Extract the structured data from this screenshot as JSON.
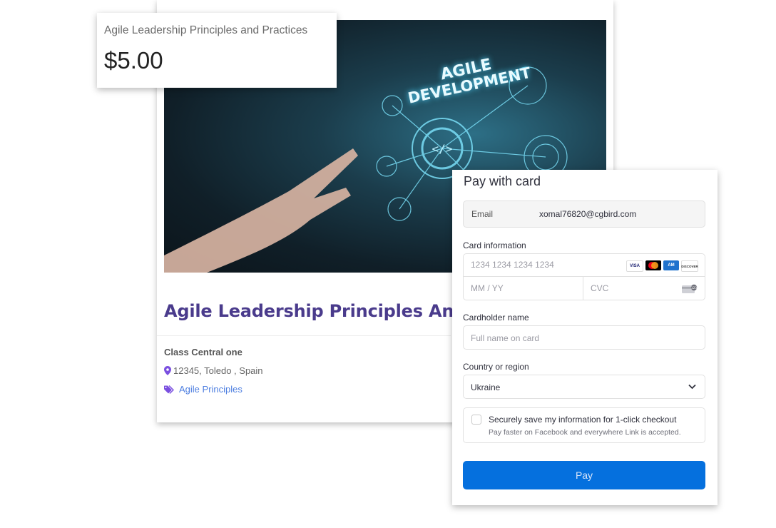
{
  "price_box": {
    "course_name": "Agile Leadership Principles and Practices",
    "price": "$5.00"
  },
  "course": {
    "hero_text_line1": "AGILE",
    "hero_text_line2": "DEVELOPMENT",
    "title": "Agile Leadership Principles And",
    "provider": "Class Central one",
    "location": "12345, Toledo , Spain",
    "tag": "Agile Principles",
    "accent_color": "#4a3b8c",
    "icons": {
      "location": "map-pin-icon",
      "tag": "tags-icon"
    }
  },
  "payment": {
    "title": "Pay with card",
    "email_label": "Email",
    "email_value": "xomal76820@cgbird.com",
    "card_info_label": "Card information",
    "card_number_placeholder": "1234 1234 1234 1234",
    "brands": [
      "VISA",
      "Mastercard",
      "Amex",
      "DISCOVER"
    ],
    "expiry_placeholder": "MM / YY",
    "cvc_placeholder": "CVC",
    "cardholder_label": "Cardholder name",
    "cardholder_placeholder": "Full name on card",
    "country_label": "Country or region",
    "country_value": "Ukraine",
    "save_title": "Securely save my information for 1-click checkout",
    "save_subtitle": "Pay faster on Facebook and everywhere Link is accepted.",
    "pay_label": "Pay",
    "pay_color": "#0570de"
  }
}
